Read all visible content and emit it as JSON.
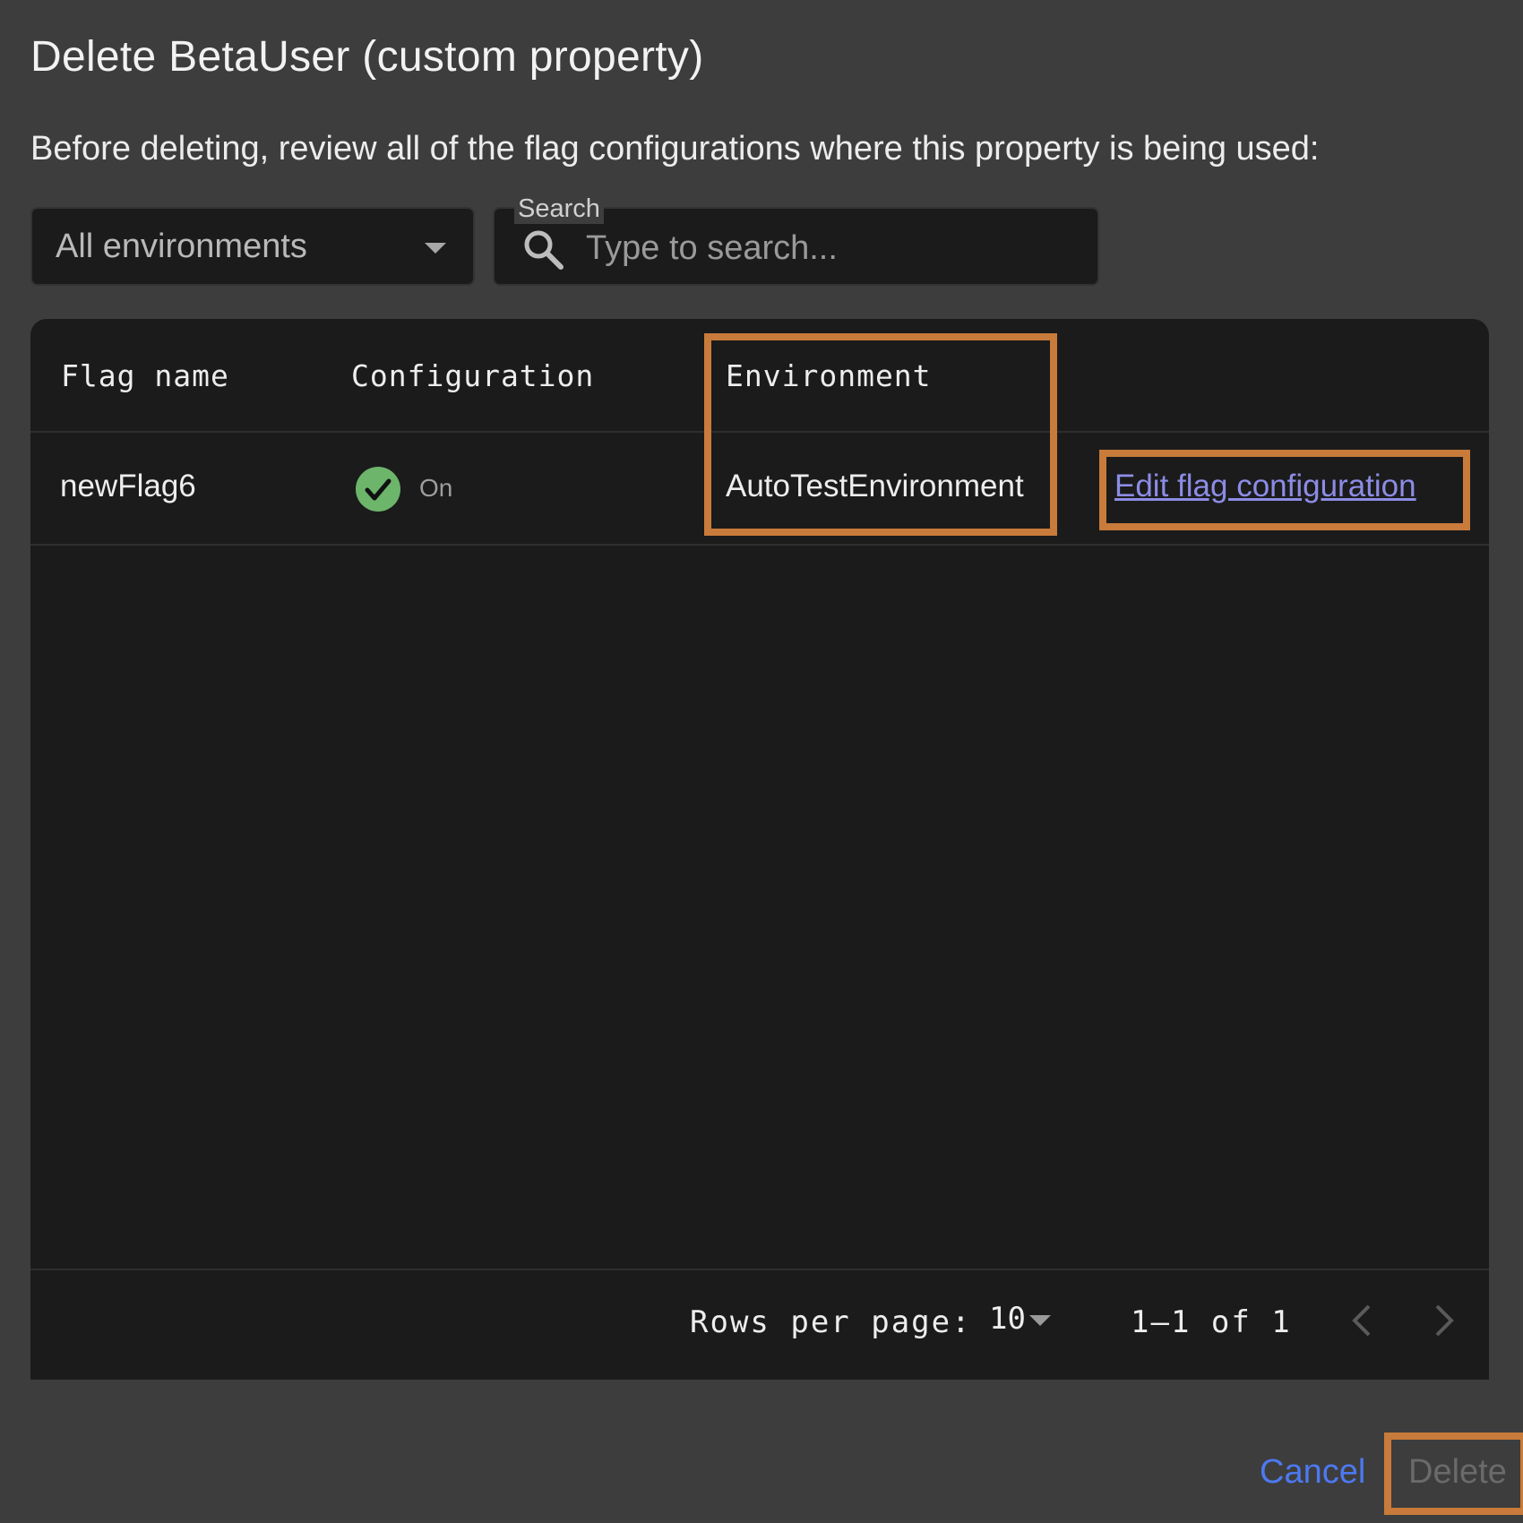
{
  "dialog": {
    "title": "Delete BetaUser (custom property)",
    "description": "Before deleting, review all of the flag configurations where this property is being used:"
  },
  "filters": {
    "environment_select": {
      "value": "All environments",
      "icon": "caret-down-icon"
    },
    "search": {
      "label": "Search",
      "placeholder": "Type to search...",
      "value": "",
      "icon": "search-icon"
    }
  },
  "table": {
    "columns": [
      "Flag name",
      "Configuration",
      "Environment",
      ""
    ],
    "rows": [
      {
        "flag_name": "newFlag6",
        "configuration": {
          "status": "On",
          "icon": "check-circle-icon",
          "color": "#6cb56b"
        },
        "environment": "AutoTestEnvironment",
        "action": "Edit flag configuration"
      }
    ],
    "pagination": {
      "rows_per_page_label": "Rows per page:",
      "rows_per_page_value": "10",
      "range": "1–1 of 1",
      "prev_icon": "chevron-left-icon",
      "next_icon": "chevron-right-icon"
    }
  },
  "actions": {
    "cancel_label": "Cancel",
    "delete_label": "Delete",
    "delete_disabled": true
  },
  "colors": {
    "background": "#3d3d3d",
    "surface": "#1b1b1b",
    "link": "#8c8ce6",
    "primary": "#4d79f0",
    "highlight": "#c87b3a",
    "success": "#6cb56b"
  }
}
